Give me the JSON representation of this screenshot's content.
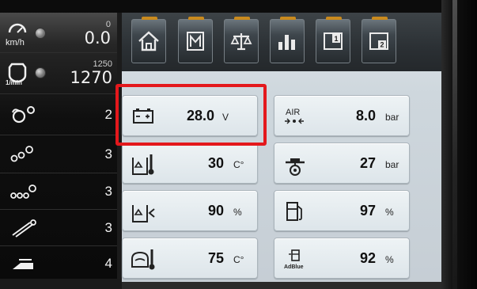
{
  "left_panel": {
    "speed": {
      "icon": "speedometer-icon",
      "unit": "km/h",
      "sub": "0",
      "value": "0.0"
    },
    "rpm": {
      "icon": "engine-rpm-icon",
      "unit": "1/min",
      "sub": "1250",
      "value": "1270"
    },
    "rows": [
      {
        "icon": "rotor-icon",
        "value": "2"
      },
      {
        "icon": "three-circles-icon",
        "value": "3"
      },
      {
        "icon": "four-circles-icon",
        "value": "3"
      },
      {
        "icon": "conveyor-icon",
        "value": "3"
      },
      {
        "icon": "header-cutter-icon",
        "value": "4"
      }
    ]
  },
  "tabs": [
    {
      "name": "home",
      "icon": "home-icon"
    },
    {
      "name": "machine",
      "icon": "machine-menu-icon"
    },
    {
      "name": "balance",
      "icon": "scale-balance-icon"
    },
    {
      "name": "statistics",
      "icon": "bar-chart-icon"
    },
    {
      "name": "screen-1",
      "icon": "page-1-icon",
      "label": "1"
    },
    {
      "name": "screen-2",
      "icon": "page-2-icon",
      "label": "2"
    }
  ],
  "tiles": [
    {
      "icon": "battery-icon",
      "value": "28.0",
      "unit": "V",
      "highlighted": true
    },
    {
      "icon": "air-pressure-icon",
      "icon_text": "AIR",
      "value": "8.0",
      "unit": "bar"
    },
    {
      "icon": "coolant-temp-icon",
      "value": "30",
      "unit": "C°"
    },
    {
      "icon": "oil-pressure-icon",
      "value": "27",
      "unit": "bar"
    },
    {
      "icon": "coolant-level-icon",
      "value": "90",
      "unit": "%"
    },
    {
      "icon": "fuel-icon",
      "value": "97",
      "unit": "%"
    },
    {
      "icon": "oil-temp-icon",
      "value": "75",
      "unit": "C°"
    },
    {
      "icon": "adblue-icon",
      "icon_text": "AdBlue",
      "value": "92",
      "unit": "%"
    }
  ],
  "colors": {
    "highlight": "#e4181c",
    "tab_accent": "#c98a1e"
  }
}
